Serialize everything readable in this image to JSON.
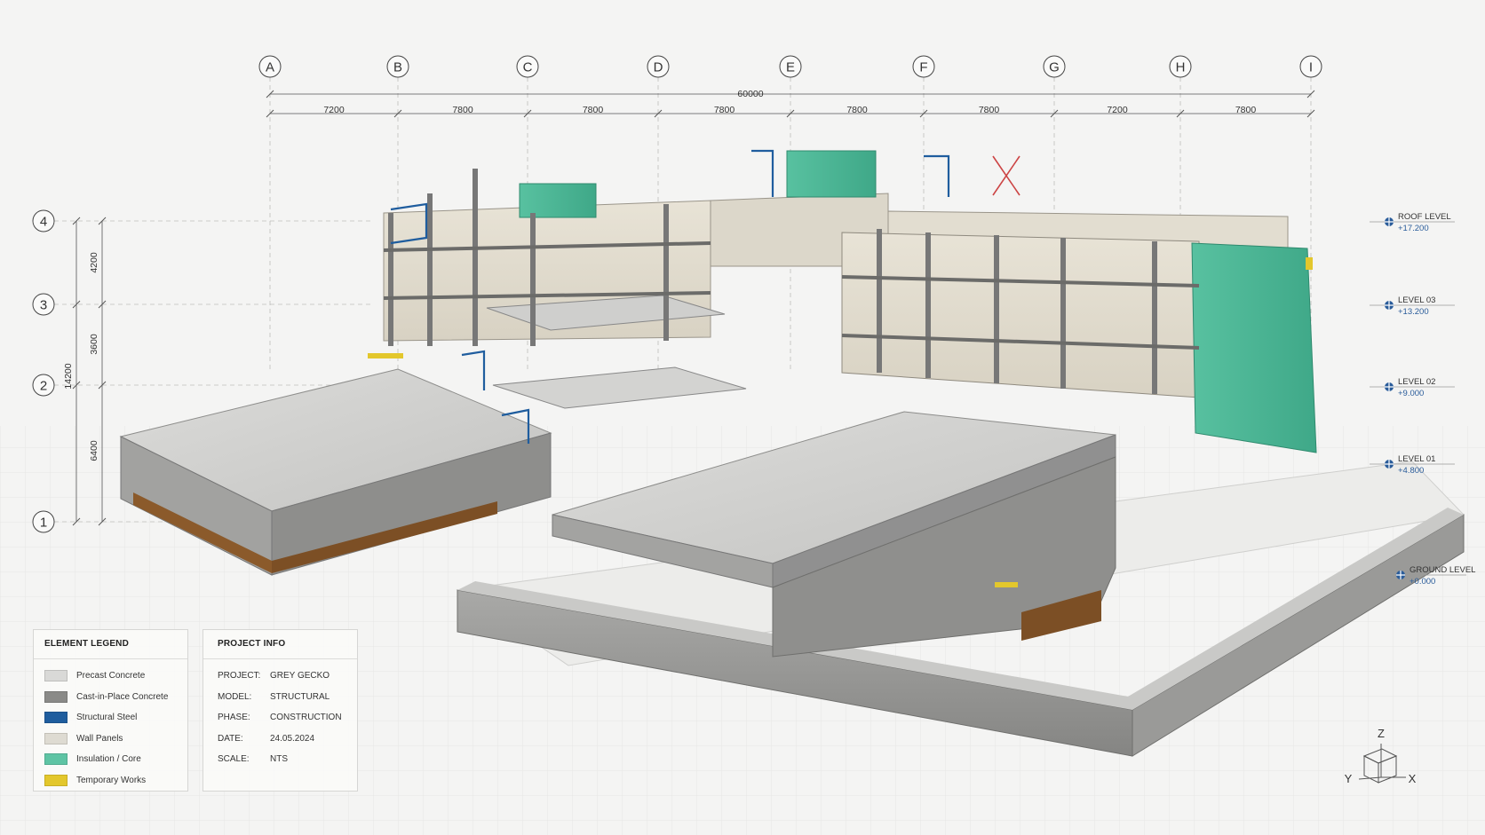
{
  "grid": {
    "columns": [
      "A",
      "B",
      "C",
      "D",
      "E",
      "F",
      "G",
      "H",
      "I"
    ],
    "rows": [
      "4",
      "3",
      "2",
      "1"
    ],
    "spacing_labels": [
      "7200",
      "7800",
      "7800",
      "7800",
      "7800",
      "7800",
      "7200",
      "7800"
    ],
    "overall_dimension": "60000",
    "vertical_dimensions": [
      "4200",
      "3600",
      "6400"
    ],
    "vertical_overall": "14200"
  },
  "levels": [
    {
      "name": "ROOF LEVEL",
      "elevation": "+17.200"
    },
    {
      "name": "LEVEL 03",
      "elevation": "+13.200"
    },
    {
      "name": "LEVEL 02",
      "elevation": "+9.000"
    },
    {
      "name": "LEVEL 01",
      "elevation": "+4.800"
    },
    {
      "name": "GROUND LEVEL",
      "elevation": "+0.000"
    }
  ],
  "legend": {
    "title": "ELEMENT LEGEND",
    "items": [
      {
        "label": "Precast Concrete",
        "color": "#d9d9d7"
      },
      {
        "label": "Cast-in-Place Concrete",
        "color": "#8a8a88"
      },
      {
        "label": "Structural Steel",
        "color": "#1f5d9e"
      },
      {
        "label": "Wall Panels",
        "color": "#dedbd2"
      },
      {
        "label": "Insulation / Core",
        "color": "#5ec4a4"
      },
      {
        "label": "Temporary Works",
        "color": "#e3c72c"
      }
    ]
  },
  "project_info": {
    "title": "PROJECT INFO",
    "rows": [
      {
        "key": "PROJECT:",
        "value": "GREY GECKO"
      },
      {
        "key": "MODEL:",
        "value": "STRUCTURAL"
      },
      {
        "key": "PHASE:",
        "value": "CONSTRUCTION"
      },
      {
        "key": "DATE:",
        "value": "24.05.2024"
      },
      {
        "key": "SCALE:",
        "value": "NTS"
      }
    ]
  },
  "axes_widget": {
    "z": "Z",
    "y": "Y",
    "x": "X"
  }
}
